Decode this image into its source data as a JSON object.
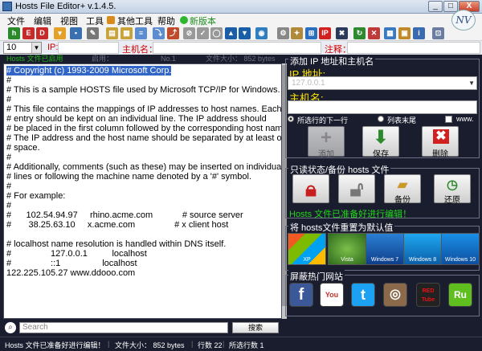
{
  "window": {
    "title": "Hosts File Editor+ v.1.4.5.",
    "minimize": "_",
    "maximize": "□",
    "close": "X",
    "logo": "NV"
  },
  "menu": {
    "items": [
      "文件",
      "编辑",
      "视图",
      "工具",
      "其他工具",
      "帮助",
      "新版本"
    ]
  },
  "fieldbar": {
    "combo_value": "10",
    "ip_label": "IP:",
    "host_label": "主机名：",
    "comment_label": "注释："
  },
  "editor_header": {
    "col1": "Hosts 文件已启用",
    "col2": "启用：",
    "col3": "No.1",
    "col4": "文件大小： 852 bytes"
  },
  "editor": {
    "lines": [
      "# Copyright (c) 1993-2009 Microsoft Corp.",
      "#",
      "# This is a sample HOSTS file used by Microsoft TCP/IP for Windows.",
      "#",
      "# This file contains the mappings of IP addresses to host names. Each",
      "# entry should be kept on an individual line. The IP address should",
      "# be placed in the first column followed by the corresponding host name.",
      "# The IP address and the host name should be separated by at least one",
      "# space.",
      "#",
      "# Additionally, comments (such as these) may be inserted on individual",
      "# lines or following the machine name denoted by a '#' symbol.",
      "#",
      "# For example:",
      "#",
      "#      102.54.94.97     rhino.acme.com            # source server",
      "#       38.25.63.10     x.acme.com                # x client host",
      "",
      "# localhost name resolution is handled within DNS itself.",
      "#                127.0.0.1          localhost",
      "#                ::1                 localhost",
      "122.225.105.27 www.ddooo.com"
    ]
  },
  "add_panel": {
    "title": "添加 IP 地址和主机名",
    "ip_label": "IP 地址:",
    "ip_placeholder": "127.0.0.1",
    "host_label": "主机名:",
    "radio1": "所选行的下一行",
    "radio2": "列表末尾",
    "check": "www.",
    "btn_add": "添加",
    "btn_save": "保存",
    "btn_delete": "删除"
  },
  "backup_panel": {
    "title": "只读状态/备份 hosts 文件",
    "btn_backup": "备份",
    "btn_restore": "还原",
    "status": "Hosts 文件已准备好进行编辑！"
  },
  "reset_panel": {
    "title": "将 hosts文件重置为默认值",
    "os": [
      "XP",
      "Vista",
      "Windows 7",
      "Windows 8",
      "Windows 10"
    ]
  },
  "sites_panel": {
    "title": "屏蔽热门网站",
    "sites": [
      "f",
      "You",
      "t",
      "◎",
      "RED Tube",
      "Ru"
    ]
  },
  "search": {
    "placeholder": "Search",
    "button": "搜索"
  },
  "statusbar": {
    "status": "Hosts 文件已准备好进行编辑！",
    "size": "文件大小：  852 bytes",
    "lines": "行数 22",
    "selected": "所选行数 1"
  },
  "colors": {
    "background": "#1a1d2e",
    "label_yellow": "#ffe600",
    "ok_green": "#22d71b",
    "field_red": "#d40000",
    "selection": "#3165c8"
  }
}
